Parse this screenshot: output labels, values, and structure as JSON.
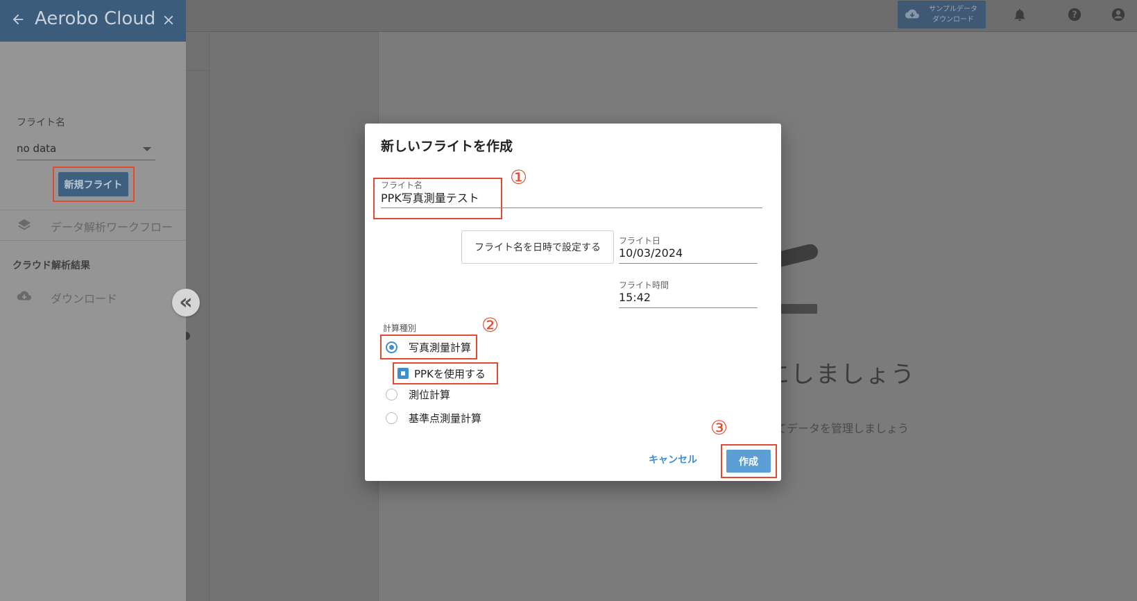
{
  "app": {
    "title": "Aerobo Cloud",
    "accent_color": "#3c5c7c",
    "highlight_color": "#e04a2f"
  },
  "topbar": {
    "sample_button": {
      "line1": "サンプルデータ",
      "line2": "ダウンロード",
      "icon": "cloud-download-icon"
    },
    "icons": [
      "bell-icon",
      "help-icon",
      "account-icon"
    ]
  },
  "sidebar": {
    "flight_name_label": "フライト名",
    "flight_select_value": "no data",
    "new_flight_button": "新規フライト",
    "workflow_item": "データ解析ワークフロー",
    "cloud_results_section": "クラウド解析結果",
    "download_item": "ダウンロード",
    "collapse_glyph": "«"
  },
  "background": {
    "heading_fragment": "にしましょう",
    "subtext_fragment": "てデータを管理しましょう"
  },
  "dialog": {
    "title": "新しいフライトを作成",
    "badges": [
      "①",
      "②",
      "③"
    ],
    "flight_name": {
      "label": "フライト名",
      "value": "PPK写真測量テスト"
    },
    "set_name_by_datetime_button": "フライト名を日時で設定する",
    "flight_date": {
      "label": "フライト日",
      "value": "10/03/2024"
    },
    "flight_time": {
      "label": "フライト時間",
      "value": "15:42"
    },
    "calc_type_label": "計算種別",
    "calc_options": [
      {
        "label": "写真測量計算",
        "selected": true
      },
      {
        "label": "測位計算",
        "selected": false
      },
      {
        "label": "基準点測量計算",
        "selected": false
      }
    ],
    "use_ppk": {
      "label": "PPKを使用する",
      "checked": true
    },
    "cancel_button": "キャンセル",
    "create_button": "作成"
  }
}
